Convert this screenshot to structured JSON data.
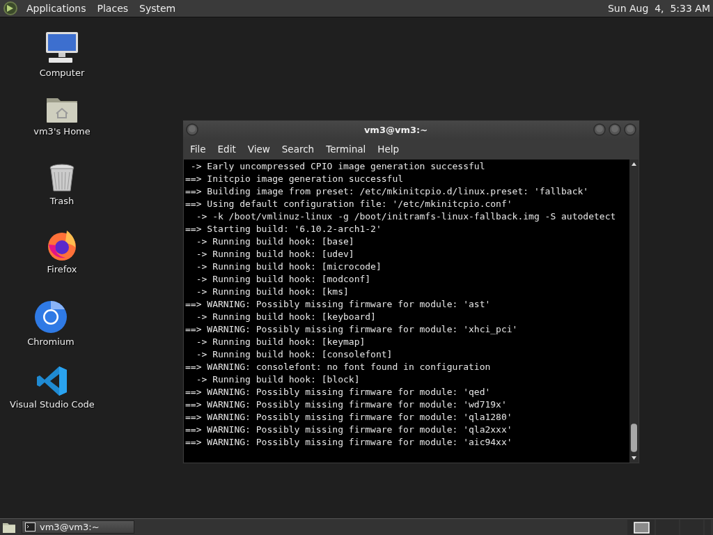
{
  "top_panel": {
    "menus": [
      "Applications",
      "Places",
      "System"
    ],
    "clock": "Sun Aug  4,  5:33 AM"
  },
  "desktop_icons": [
    {
      "kind": "computer",
      "label": "Computer"
    },
    {
      "kind": "home",
      "label": "vm3's Home"
    },
    {
      "kind": "trash",
      "label": "Trash"
    },
    {
      "kind": "firefox",
      "label": "Firefox"
    },
    {
      "kind": "chromium",
      "label": "Chromium"
    },
    {
      "kind": "vscode",
      "label": "Visual Studio Code"
    }
  ],
  "terminal": {
    "title": "vm3@vm3:~",
    "menu": [
      "File",
      "Edit",
      "View",
      "Search",
      "Terminal",
      "Help"
    ],
    "lines": [
      " -> Early uncompressed CPIO image generation successful",
      "==> Initcpio image generation successful",
      "==> Building image from preset: /etc/mkinitcpio.d/linux.preset: 'fallback'",
      "==> Using default configuration file: '/etc/mkinitcpio.conf'",
      "  -> -k /boot/vmlinuz-linux -g /boot/initramfs-linux-fallback.img -S autodetect",
      "==> Starting build: '6.10.2-arch1-2'",
      "  -> Running build hook: [base]",
      "  -> Running build hook: [udev]",
      "  -> Running build hook: [microcode]",
      "  -> Running build hook: [modconf]",
      "  -> Running build hook: [kms]",
      "==> WARNING: Possibly missing firmware for module: 'ast'",
      "  -> Running build hook: [keyboard]",
      "==> WARNING: Possibly missing firmware for module: 'xhci_pci'",
      "  -> Running build hook: [keymap]",
      "  -> Running build hook: [consolefont]",
      "==> WARNING: consolefont: no font found in configuration",
      "  -> Running build hook: [block]",
      "==> WARNING: Possibly missing firmware for module: 'qed'",
      "==> WARNING: Possibly missing firmware for module: 'wd719x'",
      "==> WARNING: Possibly missing firmware for module: 'qla1280'",
      "==> WARNING: Possibly missing firmware for module: 'qla2xxx'",
      "==> WARNING: Possibly missing firmware for module: 'aic94xx'"
    ]
  },
  "taskbar": {
    "tasks": [
      {
        "label": "vm3@vm3:~",
        "selected": true
      }
    ]
  }
}
